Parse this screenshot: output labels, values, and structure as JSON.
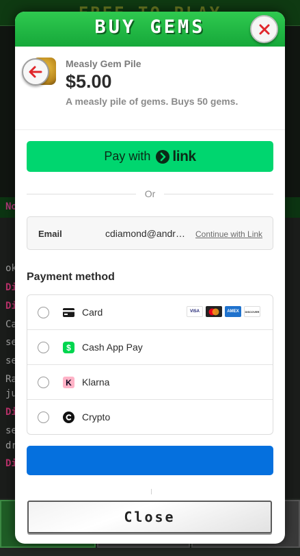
{
  "background": {
    "title": "FREE TO PLAY",
    "strip_text": "No",
    "chat_lines": [
      {
        "text": "ok",
        "style": "gray"
      },
      {
        "text": "Di",
        "style": "pink"
      },
      {
        "text": "Di",
        "style": "pink"
      },
      {
        "text": "Ca",
        "style": "gray"
      },
      {
        "text": "se",
        "style": "gray"
      },
      {
        "text": "se",
        "style": "gray"
      },
      {
        "text": "Ra",
        "style": "gray"
      },
      {
        "text": "ju",
        "style": "gray"
      },
      {
        "text": "Di",
        "style": "pink"
      },
      {
        "text": "se",
        "style": "gray"
      },
      {
        "text": "dr",
        "style": "gray"
      },
      {
        "text": "Di",
        "style": "pink"
      }
    ]
  },
  "modal": {
    "title": "BUY GEMS",
    "close_icon": "close-x-icon",
    "accent_color": "#1fb843",
    "close_icon_color": "#e0262b"
  },
  "product": {
    "name": "Measly Gem Pile",
    "price": "$5.00",
    "description": "A measly pile of gems. Buys 50 gems.",
    "back_icon": "arrow-left-icon"
  },
  "payment": {
    "link_button": {
      "label": "Pay with",
      "logo_text": "link",
      "color": "#00d66f"
    },
    "divider": "Or",
    "email": {
      "label": "Email",
      "value": "cdiamond@andre…",
      "action": "Continue with Link"
    },
    "method_title": "Payment method",
    "methods": [
      {
        "label": "Card",
        "icon": "card-icon",
        "brands": [
          "VISA",
          "MC",
          "AMEX",
          "DISCOVER"
        ]
      },
      {
        "label": "Cash App Pay",
        "icon": "cashapp-icon"
      },
      {
        "label": "Klarna",
        "icon": "klarna-icon"
      },
      {
        "label": "Crypto",
        "icon": "crypto-icon"
      }
    ],
    "submit_color": "#0570de"
  },
  "footer": {
    "close_label": "Close"
  }
}
